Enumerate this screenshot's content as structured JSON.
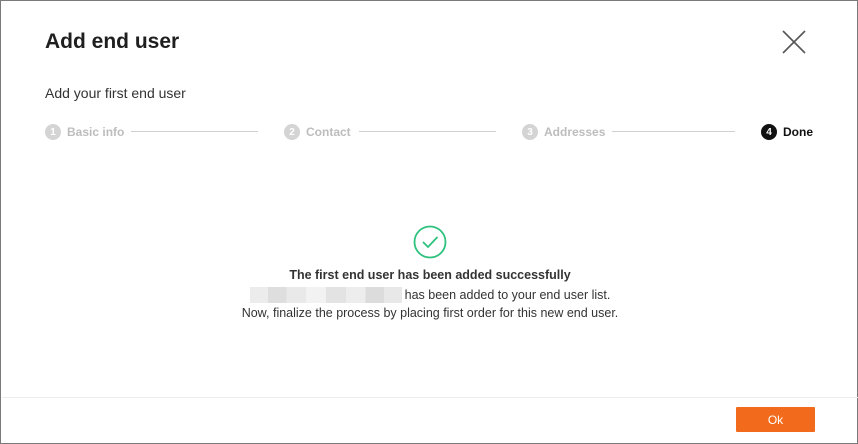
{
  "dialog": {
    "title": "Add end user",
    "subtitle": "Add your first end user"
  },
  "stepper": {
    "steps": [
      {
        "number": "1",
        "label": "Basic info",
        "active": false
      },
      {
        "number": "2",
        "label": "Contact",
        "active": false
      },
      {
        "number": "3",
        "label": "Addresses",
        "active": false
      },
      {
        "number": "4",
        "label": "Done",
        "active": true
      }
    ]
  },
  "success": {
    "icon": "check-circle-icon",
    "title": "The first end user has been added successfully",
    "line1_suffix": "has been added to your end user list.",
    "line2": "Now, finalize the process by placing first order for this new end user."
  },
  "footer": {
    "ok_label": "Ok"
  },
  "colors": {
    "accent": "#f26b1d",
    "success": "#2ec27e",
    "inactive_step": "#d4d4d4",
    "active_step": "#111111"
  }
}
